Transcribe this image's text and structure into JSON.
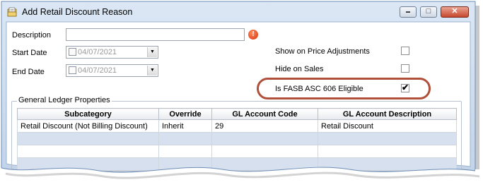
{
  "window": {
    "title": "Add Retail Discount Reason",
    "minimize_glyph": "▬",
    "restore_glyph": "□",
    "close_glyph": "✕"
  },
  "form": {
    "description_label": "Description",
    "description_value": "",
    "start_date_label": "Start Date",
    "start_date_value": "04/07/2021",
    "end_date_label": "End Date",
    "end_date_value": "04/07/2021",
    "show_on_price_adjustments_label": "Show on Price Adjustments",
    "show_on_price_adjustments_checked": false,
    "hide_on_sales_label": "Hide on Sales",
    "hide_on_sales_checked": false,
    "fasb_label": "Is FASB ASC 606 Eligible",
    "fasb_checked": true,
    "fasb_checkmark": "✔",
    "error_glyph": "!"
  },
  "gl": {
    "group_title": "General Ledger Properties",
    "columns": [
      "Subcategory",
      "Override",
      "GL Account Code",
      "GL Account Description"
    ],
    "rows": [
      [
        "Retail Discount (Not Billing Discount)",
        "Inherit",
        "29",
        "Retail Discount"
      ],
      [
        "",
        "",
        "",
        ""
      ],
      [
        "",
        "",
        "",
        ""
      ],
      [
        "",
        "",
        "",
        ""
      ]
    ]
  },
  "colors": {
    "highlight_ring": "#b0503b",
    "alt_row": "#d6e0ef",
    "frame_blue": "#c4d6ec"
  },
  "icons": {
    "window_icon": "folder-document-icon",
    "error_icon": "exclamation-icon",
    "dropdown_icon": "chevron-down-icon"
  }
}
